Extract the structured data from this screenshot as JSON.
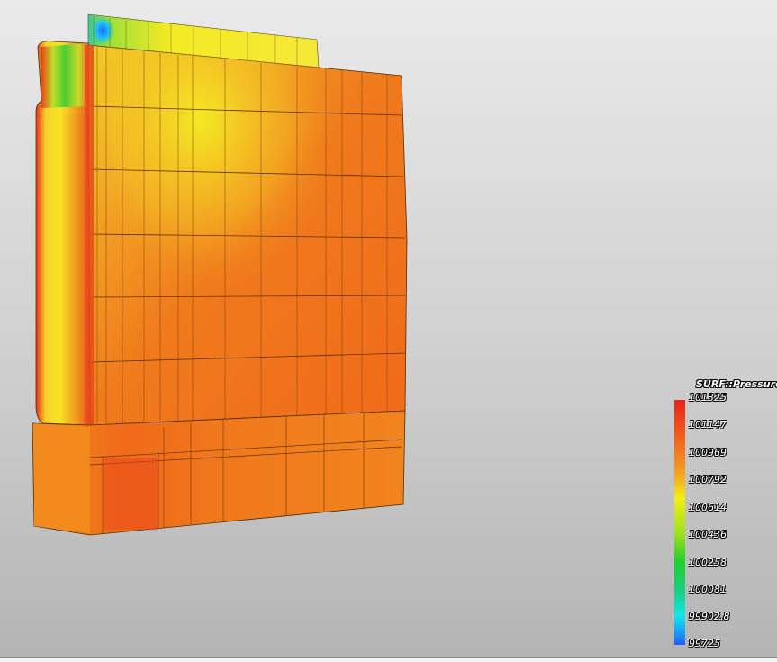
{
  "legend": {
    "title": "SURF::Pressure",
    "ticks": [
      "101325",
      "101147",
      "100969",
      "100792",
      "100614",
      "100436",
      "100258",
      "100081",
      "99902.8",
      "99725"
    ]
  }
}
